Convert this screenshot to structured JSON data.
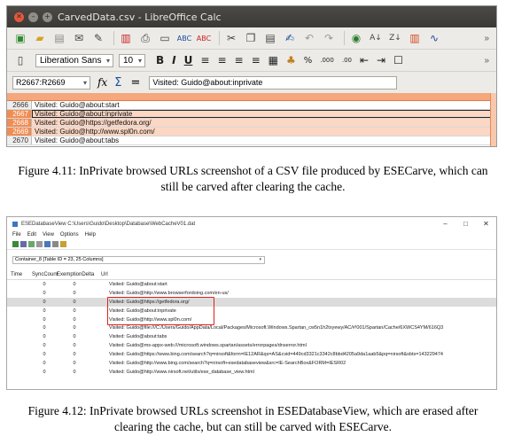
{
  "calc": {
    "window_title": "CarvedData.csv - LibreOffice Calc",
    "font_name": "Liberation Sans",
    "font_size": "10",
    "name_box": "R2667:R2669",
    "formula_content": "Visited: Guido@about:inprivate",
    "rows": [
      {
        "num": "2666",
        "text": "Visited: Guido@about:start",
        "selected": false
      },
      {
        "num": "2667",
        "text": "Visited: Guido@about:inprivate",
        "selected": true
      },
      {
        "num": "2668",
        "text": "Visited: Guido@https://getfedora.org/",
        "selected": true
      },
      {
        "num": "2669",
        "text": "Visited: Guido@http://www.spl0n.com/",
        "selected": true
      },
      {
        "num": "2670",
        "text": "Visited: Guido@about:tabs",
        "selected": false
      }
    ]
  },
  "caption1": "Figure 4.11: InPrivate browsed URLs screenshot of a CSV file produced by ESECarve, which can still be carved after clearing the cache.",
  "ese": {
    "window_title": "ESEDatabaseView  C:\\Users\\Guido\\Desktop\\Database\\WebCacheV01.dat",
    "menu": [
      "File",
      "Edit",
      "View",
      "Options",
      "Help"
    ],
    "container": "Container_8   [Table ID = 23, 25 Columns]",
    "columns": [
      "Time",
      "SyncCount",
      "ExemptionDelta",
      "Url"
    ],
    "rows": [
      {
        "sync": "0",
        "exc": "0",
        "url": "Visited: Guido@about:start"
      },
      {
        "sync": "0",
        "exc": "0",
        "url": "Visited: Guido@http://www.browserfordoing.com/en-us/"
      },
      {
        "sync": "0",
        "exc": "0",
        "url": "Visited: Guido@https://getfedora.org/"
      },
      {
        "sync": "0",
        "exc": "0",
        "url": "Visited: Guido@about:inprivate"
      },
      {
        "sync": "0",
        "exc": "0",
        "url": "Visited: Guido@http://www.spl0n.com/"
      },
      {
        "sync": "0",
        "exc": "0",
        "url": "Visited: Guido@file:///C:/Users/Guido/AppData/Local/Packages/Microsoft.Windows.Spartan_cw5n1h2txyewy/AC/#!001/Spartan/Cache/6XWCS4YM/616Q3"
      },
      {
        "sync": "0",
        "exc": "0",
        "url": "Visited: Guido@about:tabs"
      },
      {
        "sync": "0",
        "exc": "0",
        "url": "Visited: Guido@ms-appx-web:///microsoft.windows.spartan/assets/errorpages/dnserror.html"
      },
      {
        "sync": "0",
        "exc": "0",
        "url": "Visited: Guido@https://www.bing.com/search?q=nirsoft&form=IE12AR&qs=AS&cvid=449cd3321c3342c8bbd4205a9da1aab5&pq=nirsoft&sbts=143229474"
      },
      {
        "sync": "0",
        "exc": "0",
        "url": "Visited: Guido@http://www.bing.com/search?q=nirsoft+esedatabaseview&src=IE-SearchBox&FORM=IESR02"
      },
      {
        "sync": "0",
        "exc": "0",
        "url": "Visited: Guido@http://www.nirsoft.net/utils/ese_database_view.html"
      }
    ]
  },
  "caption2": "Figure 4.12: InPrivate browsed URLs screenshot in ESEDatabaseView, which are erased after clearing the cache, but can still be carved with ESECarve."
}
